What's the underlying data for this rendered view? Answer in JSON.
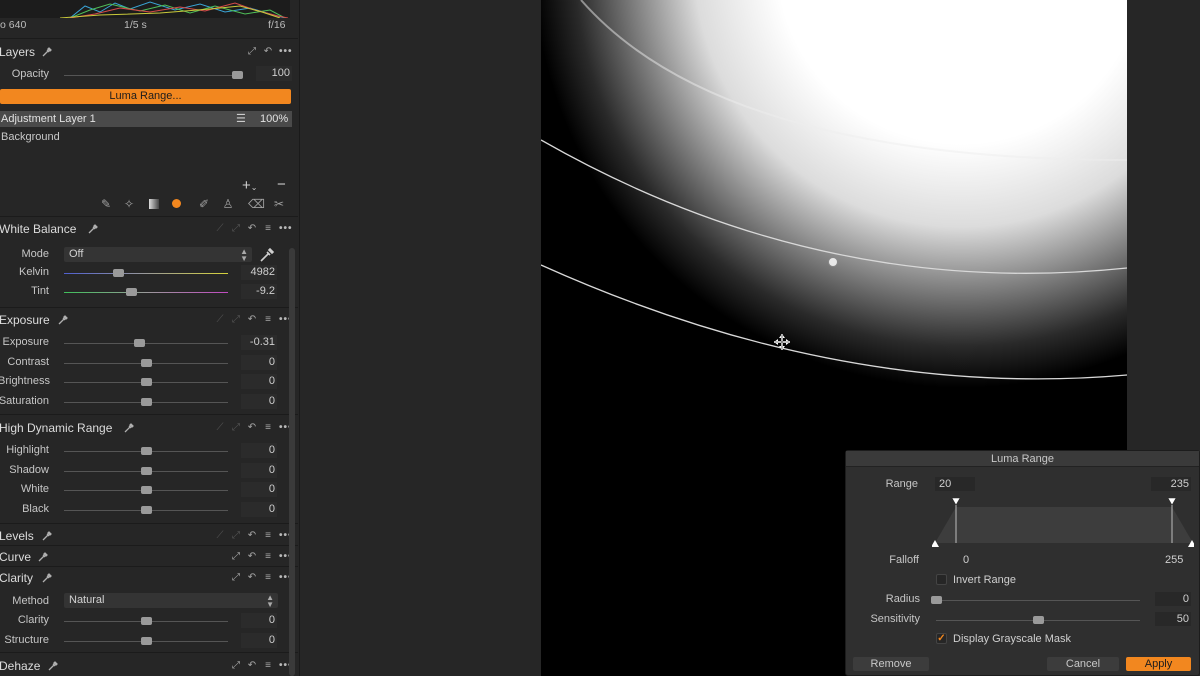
{
  "histogram_info": {
    "iso": "640",
    "shutter": "1/5 s",
    "aperture": "f/16"
  },
  "layers": {
    "title": "Layers",
    "opacity_label": "Opacity",
    "opacity_value": "100",
    "opacity_level": 0.97,
    "luma_button": "Luma Range...",
    "items": [
      {
        "name": "Adjustment Layer 1",
        "value": "100%"
      },
      {
        "name": "Background"
      }
    ],
    "add_glyph": "+",
    "remove_glyph": "−"
  },
  "white_balance": {
    "title": "White Balance",
    "mode_label": "Mode",
    "mode_value": "Off",
    "kelvin_label": "Kelvin",
    "kelvin_value": "4982",
    "kelvin_level": 0.33,
    "tint_label": "Tint",
    "tint_value": "-9.2",
    "tint_level": 0.41
  },
  "exposure": {
    "title": "Exposure",
    "rows": [
      {
        "label": "Exposure",
        "value": "-0.31",
        "level": 0.46
      },
      {
        "label": "Contrast",
        "value": "0",
        "level": 0.5
      },
      {
        "label": "Brightness",
        "value": "0",
        "level": 0.5
      },
      {
        "label": "Saturation",
        "value": "0",
        "level": 0.5
      }
    ]
  },
  "hdr": {
    "title": "High Dynamic Range",
    "rows": [
      {
        "label": "Highlight",
        "value": "0",
        "level": 0.5
      },
      {
        "label": "Shadow",
        "value": "0",
        "level": 0.5
      },
      {
        "label": "White",
        "value": "0",
        "level": 0.5
      },
      {
        "label": "Black",
        "value": "0",
        "level": 0.5
      }
    ]
  },
  "levels": {
    "title": "Levels"
  },
  "curve": {
    "title": "Curve"
  },
  "clarity": {
    "title": "Clarity",
    "method_label": "Method",
    "method_value": "Natural",
    "rows": [
      {
        "label": "Clarity",
        "value": "0",
        "level": 0.5
      },
      {
        "label": "Structure",
        "value": "0",
        "level": 0.5
      }
    ]
  },
  "dehaze": {
    "title": "Dehaze"
  },
  "luma_dialog": {
    "title": "Luma Range",
    "range_label": "Range",
    "range_low": "20",
    "range_high": "235",
    "falloff_label": "Falloff",
    "falloff_low": "0",
    "falloff_high": "255",
    "invert_label": "Invert Range",
    "invert_checked": false,
    "radius_label": "Radius",
    "radius_value": "0",
    "radius_level": 0.0,
    "sensitivity_label": "Sensitivity",
    "sensitivity_value": "50",
    "sensitivity_level": 0.5,
    "grayscale_label": "Display Grayscale Mask",
    "grayscale_checked": true,
    "remove_button": "Remove",
    "cancel_button": "Cancel",
    "apply_button": "Apply"
  },
  "colors": {
    "accent": "#f2871f",
    "panel": "#262626",
    "canvas": "#000000"
  }
}
